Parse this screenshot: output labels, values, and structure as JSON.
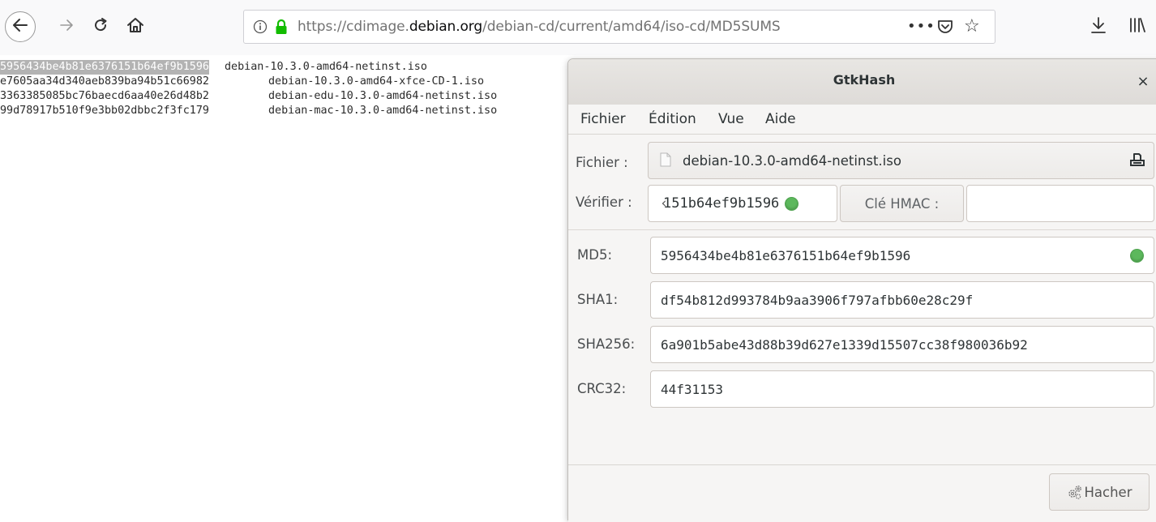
{
  "browser": {
    "url": {
      "prefix": "https://cdimage.",
      "domain": "debian.org",
      "path": "/debian-cd/current/amd64/iso-cd/MD5SUMS"
    },
    "icons": {
      "back": "back-arrow-icon",
      "forward": "forward-arrow-icon",
      "reload": "reload-icon",
      "home": "home-icon",
      "info": "info-icon",
      "lock": "lock-icon",
      "more": "more-actions-icon",
      "pocket": "pocket-icon",
      "bookmark": "star-icon",
      "downloads": "download-icon",
      "library": "library-icon"
    },
    "lock_color": "#12bc00"
  },
  "page": {
    "lines": [
      {
        "hash": "5956434be4b81e6376151b64ef9b1596",
        "file": "debian-10.3.0-amd64-netinst.iso",
        "selected": true
      },
      {
        "hash": "e7605aa34d340aeb839ba94b51c66982",
        "file": "debian-10.3.0-amd64-xfce-CD-1.iso",
        "selected": false
      },
      {
        "hash": "3363385085bc76baecd6aa40e26d48b2",
        "file": "debian-edu-10.3.0-amd64-netinst.iso",
        "selected": false
      },
      {
        "hash": "99d78917b510f9e3bb02dbbc2f3fc179",
        "file": "debian-mac-10.3.0-amd64-netinst.iso",
        "selected": false
      }
    ]
  },
  "gtkhash": {
    "title": "GtkHash",
    "close": "×",
    "menu": [
      "Fichier",
      "Édition",
      "Vue",
      "Aide"
    ],
    "file_label": "Fichier :",
    "file_name": "debian-10.3.0-amd64-netinst.iso",
    "verify_label": "Vérifier :",
    "verify_value": "151b64ef9b1596",
    "verify_status": "match",
    "hmac_button": "Clé HMAC :",
    "hmac_value": "",
    "hashes": [
      {
        "label": "MD5:",
        "value": "5956434be4b81e6376151b64ef9b1596",
        "match": true
      },
      {
        "label": "SHA1:",
        "value": "df54b812d993784b9aa3906f797afbb60e28c29f",
        "match": false
      },
      {
        "label": "SHA256:",
        "value": "6a901b5abe43d88b39d627e1339d15507cc38f980036b92",
        "match": false
      },
      {
        "label": "CRC32:",
        "value": "44f31153",
        "match": false
      }
    ],
    "hash_button": "Hacher",
    "match_color": "#5cb85c"
  }
}
